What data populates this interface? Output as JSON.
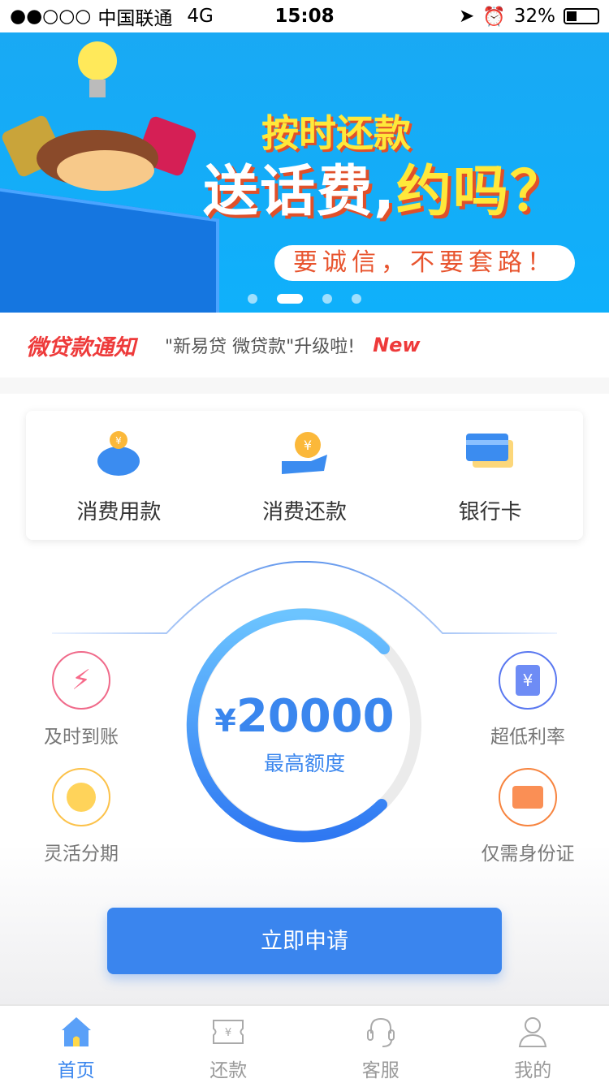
{
  "status": {
    "signal": "●●○○○",
    "carrier": "中国联通",
    "network": "4G",
    "time": "15:08",
    "battery": "32%"
  },
  "banner": {
    "line1": "按时还款",
    "line2a": "送话费,",
    "line2b": "约吗？",
    "line3": "要诚信，不要套路！",
    "slides": 4,
    "active_slide": 2
  },
  "notice": {
    "title": "微贷款通知",
    "text": "\"新易贷 微贷款\"升级啦!",
    "badge": "New"
  },
  "quick": [
    {
      "label": "消费用款",
      "icon": "piggy-bank-icon"
    },
    {
      "label": "消费还款",
      "icon": "coin-hand-icon"
    },
    {
      "label": "银行卡",
      "icon": "bank-card-icon"
    }
  ],
  "features": [
    {
      "label": "及时到账",
      "icon": "lightning-icon",
      "color": "#f06a8a"
    },
    {
      "label": "灵活分期",
      "icon": "clock-icon",
      "color": "#fcc24a"
    },
    {
      "label": "超低利率",
      "icon": "yuan-doc-icon",
      "color": "#5a78f0"
    },
    {
      "label": "仅需身份证",
      "icon": "id-card-icon",
      "color": "#f7843f"
    }
  ],
  "credit": {
    "currency": "¥",
    "amount": "20000",
    "label": "最高额度"
  },
  "apply_label": "立即申请",
  "tabs": [
    {
      "label": "首页",
      "icon": "home-icon",
      "active": true
    },
    {
      "label": "还款",
      "icon": "repay-ticket-icon"
    },
    {
      "label": "客服",
      "icon": "headset-icon"
    },
    {
      "label": "我的",
      "icon": "user-icon"
    }
  ],
  "colors": {
    "primary": "#3a85ee",
    "notice_red": "#ee3a3a",
    "banner_blue": "#19a9f4"
  }
}
